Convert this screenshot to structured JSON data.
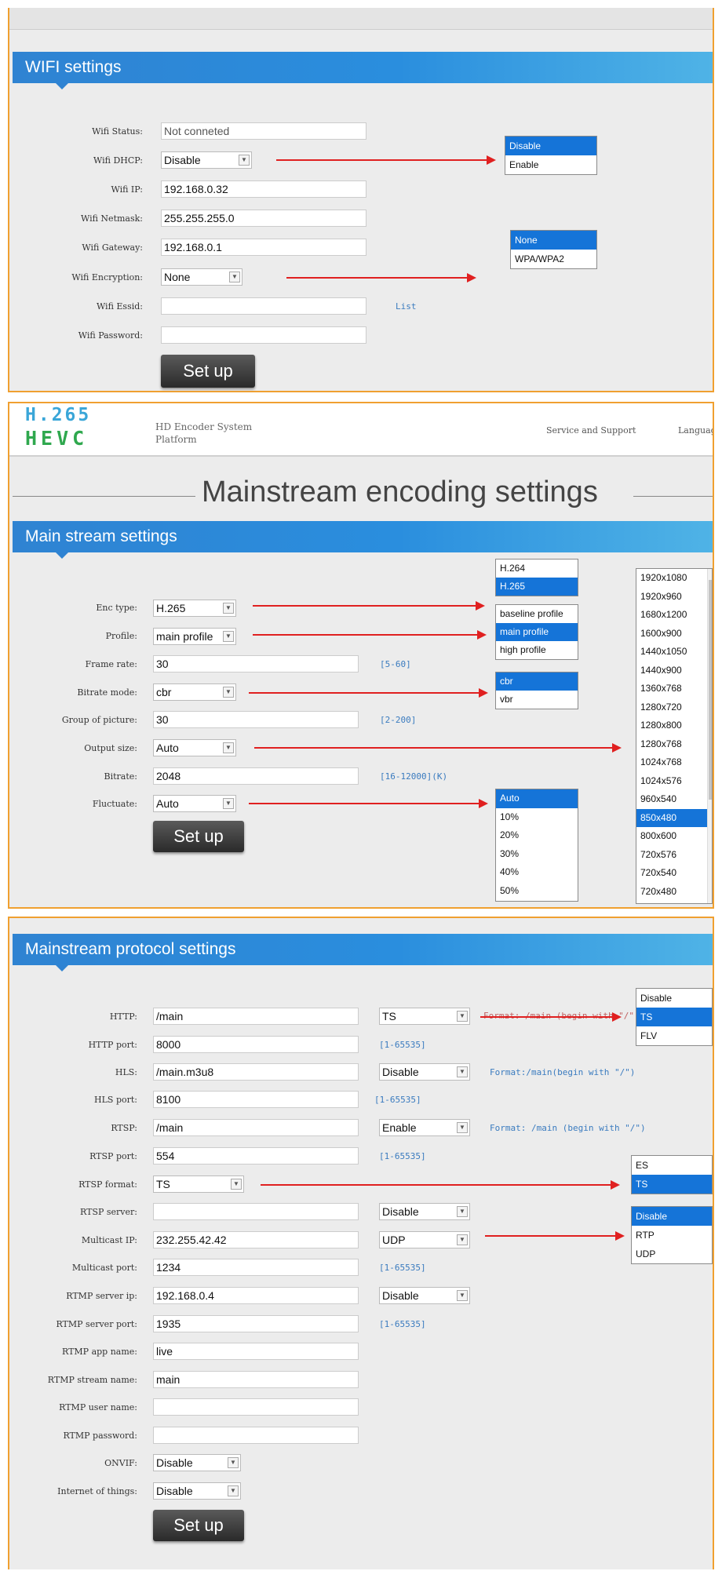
{
  "wifi": {
    "title": "WIFI settings",
    "labels": [
      "Wifi Status:",
      "Wifi DHCP:",
      "Wifi IP:",
      "Wifi Netmask:",
      "Wifi Gateway:",
      "Wifi Encryption:",
      "Wifi Essid:",
      "Wifi Password:"
    ],
    "status": "Not conneted",
    "dhcp": "Disable",
    "ip": "192.168.0.32",
    "netmask": "255.255.255.0",
    "gateway": "192.168.0.1",
    "encryption": "None",
    "essid": "",
    "password": "",
    "list_link": "List",
    "setup": "Set up",
    "dhcp_options": [
      "Disable",
      "Enable"
    ],
    "enc_options": [
      "None",
      "WPA/WPA2"
    ]
  },
  "header": {
    "logo_top": "H.265",
    "logo_bottom": "HEVC",
    "platform_line1": "HD Encoder System",
    "platform_line2": "Platform",
    "service": "Service and Support",
    "language": "Language"
  },
  "main": {
    "page_title": "Mainstream encoding settings",
    "title": "Main stream settings",
    "labels": [
      "Enc type:",
      "Profile:",
      "Frame rate:",
      "Bitrate mode:",
      "Group of picture:",
      "Output size:",
      "Bitrate:",
      "Fluctuate:"
    ],
    "enc_type": "H.265",
    "profile": "main profile",
    "frame_rate": "30",
    "frame_rate_hint": "[5-60]",
    "bitrate_mode": "cbr",
    "gop": "30",
    "gop_hint": "[2-200]",
    "output_size": "Auto",
    "bitrate": "2048",
    "bitrate_hint": "[16-12000](K)",
    "fluctuate": "Auto",
    "setup": "Set up",
    "enc_options": [
      "H.264",
      "H.265"
    ],
    "profile_options": [
      "baseline profile",
      "main profile",
      "high profile"
    ],
    "mode_options": [
      "cbr",
      "vbr"
    ],
    "fluct_options": [
      "Auto",
      "10%",
      "20%",
      "30%",
      "40%",
      "50%"
    ],
    "size_options": [
      "1920x1080",
      "1920x960",
      "1680x1200",
      "1600x900",
      "1440x1050",
      "1440x900",
      "1360x768",
      "1280x720",
      "1280x800",
      "1280x768",
      "1024x768",
      "1024x576",
      "960x540",
      "850x480",
      "800x600",
      "720x576",
      "720x540",
      "720x480"
    ]
  },
  "protocol": {
    "title": "Mainstream protocol settings",
    "labels": [
      "HTTP:",
      "HTTP port:",
      "HLS:",
      "HLS port:",
      "RTSP:",
      "RTSP port:",
      "RTSP format:",
      "RTSP server:",
      "Multicast IP:",
      "Multicast port:",
      "RTMP server ip:",
      "RTMP server port:",
      "RTMP app name:",
      "RTMP stream name:",
      "RTMP user name:",
      "RTMP password:",
      "ONVIF:",
      "Internet of things:"
    ],
    "http": "/main",
    "http_format": "TS",
    "http_hint": "Format: /main (begin with \"/\")",
    "http_port": "8000",
    "port_hint": "[1-65535]",
    "hls": "/main.m3u8",
    "hls_sel": "Disable",
    "hls_hint": "Format:/main(begin with \"/\")",
    "hls_port": "8100",
    "rtsp": "/main",
    "rtsp_sel": "Enable",
    "rtsp_hint": "Format: /main (begin with \"/\")",
    "rtsp_port": "554",
    "rtsp_format": "TS",
    "rtsp_server": "",
    "rtsp_server_sel": "Disable",
    "multicast_ip": "232.255.42.42",
    "multicast_sel": "UDP",
    "multicast_port": "1234",
    "rtmp_ip": "192.168.0.4",
    "rtmp_sel": "Disable",
    "rtmp_port": "1935",
    "rtmp_app": "live",
    "rtmp_stream": "main",
    "rtmp_user": "",
    "rtmp_pass": "",
    "onvif": "Disable",
    "iot": "Disable",
    "setup": "Set up",
    "http_options": [
      "Disable",
      "TS",
      "FLV"
    ],
    "rtspfmt_options": [
      "ES",
      "TS"
    ],
    "mc_options": [
      "Disable",
      "RTP",
      "UDP"
    ]
  }
}
